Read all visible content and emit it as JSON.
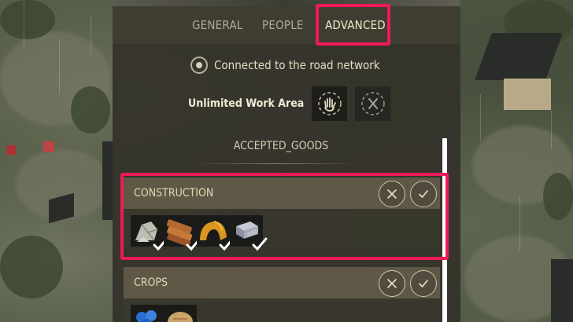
{
  "tabs": [
    {
      "label": "GENERAL",
      "active": false
    },
    {
      "label": "PEOPLE",
      "active": false
    },
    {
      "label": "ADVANCED",
      "active": true
    }
  ],
  "status": {
    "text": "Connected to the road network",
    "icon": "radio-icon"
  },
  "work_area": {
    "label": "Unlimited Work Area",
    "buttons": [
      {
        "name": "hand-icon",
        "selected": true
      },
      {
        "name": "x-circle-icon",
        "selected": false
      }
    ]
  },
  "accepted_goods": {
    "title": "ACCEPTED_GOODS",
    "categories": [
      {
        "name": "CONSTRUCTION",
        "highlighted": true,
        "items": [
          {
            "icon": "stone-icon",
            "accepted": true
          },
          {
            "icon": "planks-icon",
            "accepted": true
          },
          {
            "icon": "roof-tiles-icon",
            "accepted": true
          },
          {
            "icon": "iron-ingot-icon",
            "accepted": true
          }
        ]
      },
      {
        "name": "CROPS",
        "highlighted": false,
        "items": [
          {
            "icon": "blueberries-icon",
            "accepted": true
          },
          {
            "icon": "bread-icon",
            "accepted": true
          }
        ]
      }
    ]
  },
  "colors": {
    "highlight": "#f0195a",
    "panel": "#34322a",
    "text_light": "#e6dcc2",
    "check": "#ffffff"
  }
}
